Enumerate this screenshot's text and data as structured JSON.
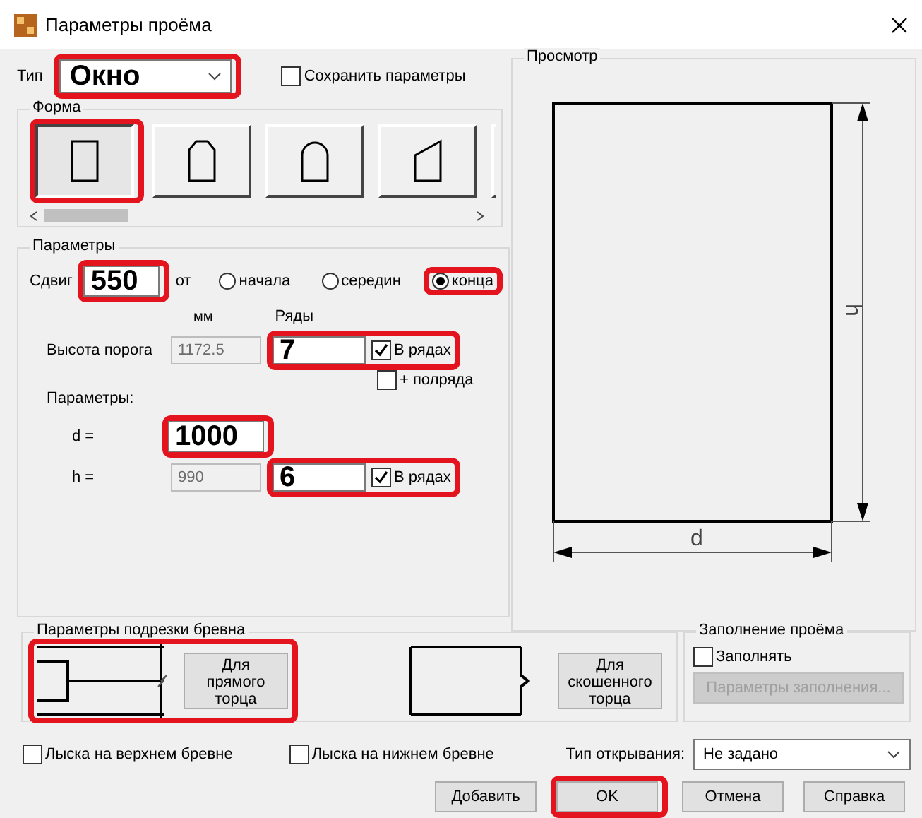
{
  "window": {
    "title": "Параметры проёма"
  },
  "type_field": {
    "label": "Тип",
    "value": "Окно",
    "highlighted": true
  },
  "save_params": {
    "label": "Сохранить параметры",
    "checked": false
  },
  "shape": {
    "title": "Форма",
    "options": [
      {
        "kind": "rect",
        "selected": true,
        "highlighted": true
      },
      {
        "kind": "pentagon",
        "selected": false,
        "highlighted": false
      },
      {
        "kind": "arch",
        "selected": false,
        "highlighted": false
      },
      {
        "kind": "slant",
        "selected": false,
        "highlighted": false
      },
      {
        "kind": "blank",
        "selected": false,
        "highlighted": false
      }
    ]
  },
  "params": {
    "title": "Параметры",
    "shift_label": "Сдвиг",
    "shift": {
      "value": "550",
      "highlighted": true
    },
    "from_label": "от",
    "unit": "мм",
    "rows_label": "Ряды",
    "origin": [
      {
        "label": "начала",
        "selected": false,
        "highlighted": false
      },
      {
        "label": "середин",
        "selected": false,
        "highlighted": false
      },
      {
        "label": "конца",
        "selected": true,
        "highlighted": true
      }
    ],
    "sill": {
      "label": "Высота порога",
      "value": "1172.5",
      "disabled": true,
      "rows": "7",
      "in_rows": {
        "label": "В рядах",
        "checked": true
      },
      "highlighted": true
    },
    "half_row": {
      "label": "+ полряда",
      "checked": false
    },
    "dims_label": "Параметры:",
    "d": {
      "label": "d =",
      "value": "1000",
      "highlighted": true
    },
    "h": {
      "label": "h =",
      "value": "990",
      "disabled": true,
      "rows": "6",
      "in_rows": {
        "label": "В рядах",
        "checked": true
      },
      "highlighted": true
    }
  },
  "preview": {
    "title": "Просмотр",
    "width_label": "d",
    "height_label": "h"
  },
  "log_cut": {
    "title": "Параметры подрезки бревна",
    "buttons": [
      {
        "kind": "straight",
        "label": "Для прямого торца",
        "highlighted": true
      },
      {
        "kind": "bevel",
        "label": "Для скошенного торца",
        "highlighted": false
      }
    ]
  },
  "fill": {
    "title": "Заполнение проёма",
    "checkbox": {
      "label": "Заполнять",
      "checked": false
    },
    "button": {
      "label": "Параметры заполнения...",
      "disabled": true
    }
  },
  "options": [
    {
      "label": "Лыска на верхнем бревне",
      "checked": false
    },
    {
      "label": "Лыска на нижнем бревне",
      "checked": false
    }
  ],
  "opening": {
    "label": "Тип открывания:",
    "value": "Не задано"
  },
  "buttons": [
    {
      "label": "Добавить",
      "highlighted": false
    },
    {
      "label": "OK",
      "highlighted": true
    },
    {
      "label": "Отмена",
      "highlighted": false
    },
    {
      "label": "Справка",
      "highlighted": false
    }
  ]
}
